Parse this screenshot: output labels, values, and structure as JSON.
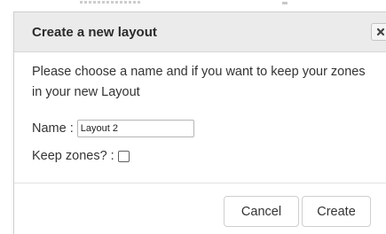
{
  "dialog": {
    "title": "Create a new layout",
    "message": "Please choose a name and if you want to keep your zones in your new Layout",
    "name_label": "Name :",
    "name_value": "Layout 2",
    "keep_zones_label": "Keep zones? :",
    "keep_zones_checked": false,
    "cancel_label": "Cancel",
    "create_label": "Create"
  },
  "icons": {
    "close": "close-icon"
  },
  "colors": {
    "titlebar_bg": "#ebebeb",
    "text": "#333333"
  }
}
